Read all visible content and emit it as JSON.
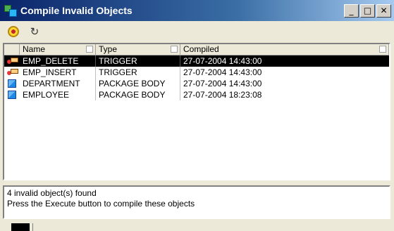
{
  "window": {
    "title": "Compile Invalid Objects"
  },
  "title_buttons": {
    "minimize": "_",
    "maximize": "□",
    "close": "✕"
  },
  "toolbar": {
    "execute_icon": "gear-icon",
    "refresh_icon": "refresh-icon",
    "refresh_glyph": "↻"
  },
  "table": {
    "columns": [
      "Name",
      "Type",
      "Compiled"
    ],
    "rows": [
      {
        "icon": "trigger-icon",
        "name": "EMP_DELETE",
        "type": "TRIGGER",
        "compiled": "27-07-2004 14:43:00",
        "selected": true
      },
      {
        "icon": "trigger-icon",
        "name": "EMP_INSERT",
        "type": "TRIGGER",
        "compiled": "27-07-2004 14:43:00",
        "selected": false
      },
      {
        "icon": "package-icon",
        "name": "DEPARTMENT",
        "type": "PACKAGE BODY",
        "compiled": "27-07-2004 14:43:00",
        "selected": false
      },
      {
        "icon": "package-icon",
        "name": "EMPLOYEE",
        "type": "PACKAGE BODY",
        "compiled": "27-07-2004 18:23:08",
        "selected": false
      }
    ]
  },
  "status": {
    "line1": "4 invalid object(s) found",
    "line2": "Press the Execute button to compile these objects"
  },
  "colors": {
    "title_start": "#0a246a",
    "title_end": "#a6caf0",
    "selection": "#000000",
    "face": "#ece9d8"
  }
}
